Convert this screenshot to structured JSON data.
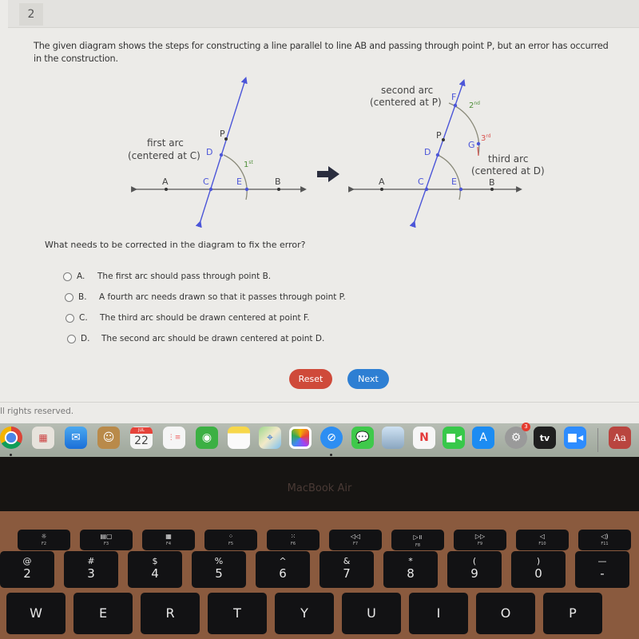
{
  "question": {
    "number": "2",
    "text": "The given diagram shows the steps for constructing a line parallel to line AB and passing through point P, but an error has occurred in the construction.",
    "prompt": "What needs to be corrected in the diagram to fix the error?",
    "choices": [
      {
        "letter": "A.",
        "text": "The first arc should pass through point B.",
        "selected": false
      },
      {
        "letter": "B.",
        "text": "A fourth arc needs drawn so that it passes through point P.",
        "selected": false
      },
      {
        "letter": "C.",
        "text": "The third arc should be drawn centered at point F.",
        "selected": false
      },
      {
        "letter": "D.",
        "text": "The second arc should be drawn centered at point D.",
        "selected": false
      }
    ]
  },
  "diagram": {
    "left": {
      "points": {
        "A": "A",
        "C": "C",
        "E": "E",
        "B": "B",
        "D": "D",
        "P": "P"
      },
      "arc_label_line1": "first arc",
      "arc_label_line2": "(centered at C)",
      "arc_ordinal": "1",
      "arc_ordinal_suffix": "st"
    },
    "arrow": "right-arrow",
    "right": {
      "points": {
        "A": "A",
        "C": "C",
        "E": "E",
        "B": "B",
        "D": "D",
        "P": "P",
        "F": "F",
        "G": "G"
      },
      "second_label_line1": "second arc",
      "second_label_line2": "(centered at P)",
      "second_ordinal": "2",
      "second_ordinal_suffix": "nd",
      "third_label_line1": "third arc",
      "third_label_line2": "(centered at D)",
      "third_ordinal": "3",
      "third_ordinal_suffix": "rd"
    },
    "colors": {
      "transversal": "#4b55d8",
      "line": "#555555",
      "arc": "#8a8a7a",
      "ordinal_green": "#4f8f3a",
      "ordinal_red": "#d9534f",
      "point_label_blue": "#4b55d8"
    }
  },
  "buttons": {
    "reset": "Reset",
    "next": "Next"
  },
  "footer": {
    "copyright": "ll rights reserved."
  },
  "dock": {
    "calendar_month": "JUL",
    "calendar_day": "22",
    "settings_badge": "3",
    "tv_label": "tv",
    "dictionary_label": "Aa",
    "apps": [
      "chrome",
      "launchpad",
      "mail",
      "contacts",
      "calendar",
      "reminders",
      "find-my",
      "notes",
      "maps",
      "photos",
      "safari",
      "messages",
      "preview",
      "news",
      "facetime",
      "app-store",
      "system-preferences",
      "apple-tv",
      "zoom",
      "dictionary"
    ]
  },
  "laptop": {
    "label": "MacBook Air",
    "fkeys": [
      {
        "glyph": "☼",
        "name": "F2"
      },
      {
        "glyph": "▤▢",
        "name": "F3"
      },
      {
        "glyph": "▦",
        "name": "F4"
      },
      {
        "glyph": "⁘",
        "name": "F5"
      },
      {
        "glyph": "⁙",
        "name": "F6"
      },
      {
        "glyph": "◁◁",
        "name": "F7"
      },
      {
        "glyph": "▷॥",
        "name": "F8"
      },
      {
        "glyph": "▷▷",
        "name": "F9"
      },
      {
        "glyph": "◁",
        "name": "F10"
      },
      {
        "glyph": "◁)",
        "name": "F11"
      }
    ],
    "numkeys": [
      {
        "sym": "@",
        "num": "2"
      },
      {
        "sym": "#",
        "num": "3"
      },
      {
        "sym": "$",
        "num": "4"
      },
      {
        "sym": "%",
        "num": "5"
      },
      {
        "sym": "^",
        "num": "6"
      },
      {
        "sym": "&",
        "num": "7"
      },
      {
        "sym": "*",
        "num": "8"
      },
      {
        "sym": "(",
        "num": "9"
      },
      {
        "sym": ")",
        "num": "0"
      },
      {
        "sym": "—",
        "num": "-"
      }
    ],
    "letterkeys": [
      "W",
      "E",
      "R",
      "T",
      "Y",
      "U",
      "I",
      "O",
      "P"
    ]
  }
}
